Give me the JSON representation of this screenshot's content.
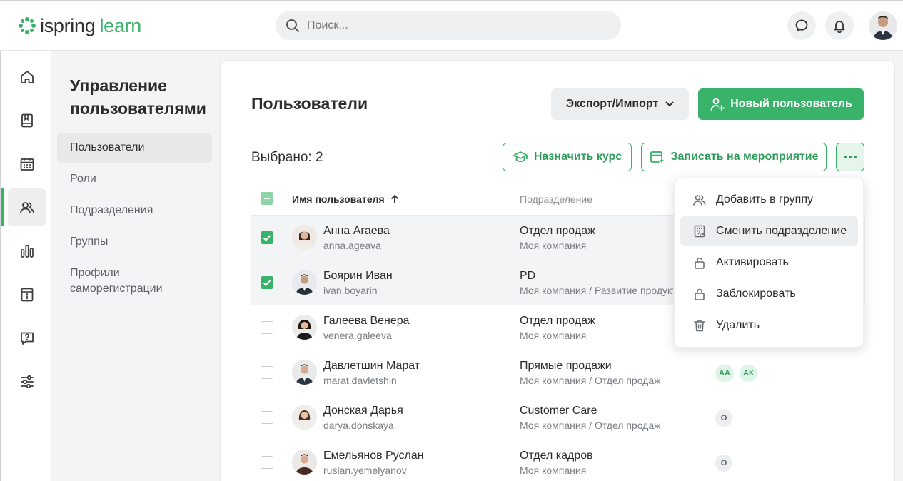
{
  "app": {
    "logo_word1": "ispring",
    "logo_word2": "learn",
    "accent_color": "#3ab36a"
  },
  "search": {
    "placeholder": "Поиск..."
  },
  "topbar_icons": [
    "chat-icon",
    "bell-icon",
    "user-avatar"
  ],
  "rail": {
    "items": [
      "home-icon",
      "book-icon",
      "calendar-icon",
      "users-icon",
      "chart-icon",
      "info-icon",
      "question-icon",
      "sliders-icon"
    ],
    "active": "users-icon"
  },
  "subnav": {
    "title": "Управление пользователями",
    "items": [
      {
        "label": "Пользователи",
        "active": true
      },
      {
        "label": "Роли"
      },
      {
        "label": "Подразделения"
      },
      {
        "label": "Группы"
      },
      {
        "label": "Профили саморегистрации"
      }
    ]
  },
  "main": {
    "title": "Пользователи",
    "export_label": "Экспорт/Импорт",
    "new_user_label": "Новый пользователь",
    "selected_label": "Выбрано: 2",
    "assign_course_label": "Назначить курс",
    "enroll_event_label": "Записать на мероприятие"
  },
  "table": {
    "columns": [
      "Имя пользователя",
      "Подразделение"
    ],
    "rows": [
      {
        "name": "Анна Агаева",
        "login": "anna.ageava",
        "dept": "Отдел продаж",
        "path": "Моя компания",
        "checked": true,
        "chips": []
      },
      {
        "name": "Боярин Иван",
        "login": "ivan.boyarin",
        "dept": "PD",
        "path": "Моя компания / Развитие продуктов",
        "checked": true,
        "chips": []
      },
      {
        "name": "Галеева Венера",
        "login": "venera.galeeva",
        "dept": "Отдел продаж",
        "path": "Моя компания",
        "checked": false,
        "chips": []
      },
      {
        "name": "Давлетшин Марат",
        "login": "marat.davletshin",
        "dept": "Прямые продажи",
        "path": "Моя компания / Отдел продаж",
        "checked": false,
        "chips": [
          "АА",
          "АК"
        ]
      },
      {
        "name": "Донская Дарья",
        "login": "darya.donskaya",
        "dept": "Customer Care",
        "path": "Моя компания / Отдел продаж",
        "checked": false,
        "chips": [
          "О"
        ]
      },
      {
        "name": "Емельянов Руслан",
        "login": "ruslan.yemelyanov",
        "dept": "Отдел кадров",
        "path": "Моя компания",
        "checked": false,
        "chips": [
          "О"
        ]
      }
    ]
  },
  "menu": {
    "items": [
      {
        "label": "Добавить в группу",
        "icon": "users-add-icon"
      },
      {
        "label": "Сменить подразделение",
        "icon": "building-icon"
      },
      {
        "label": "Активировать",
        "icon": "unlock-icon"
      },
      {
        "label": "Заблокировать",
        "icon": "lock-icon"
      },
      {
        "label": "Удалить",
        "icon": "trash-icon"
      }
    ]
  }
}
